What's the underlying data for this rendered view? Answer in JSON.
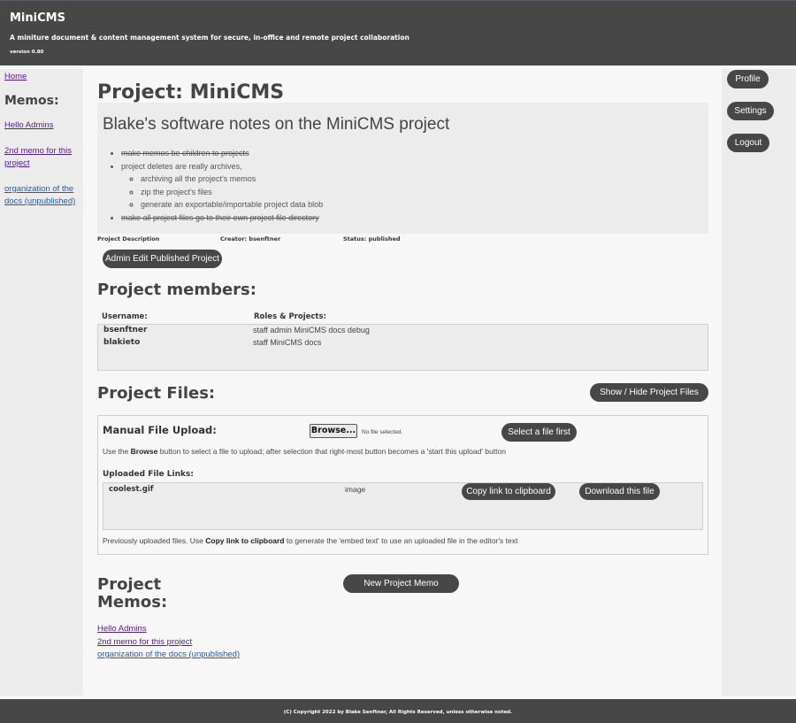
{
  "header": {
    "app_title": "MiniCMS",
    "tagline": "A miniture document & content management system for secure, in-office and remote project collaboration",
    "version": "version 0.80"
  },
  "left_sidebar": {
    "home": "Home",
    "memos_heading": "Memos:",
    "memos": [
      "Hello Admins",
      "2nd memo for this project",
      "organization of the docs (unpublished)"
    ]
  },
  "right_sidebar": {
    "profile": "Profile",
    "settings": "Settings",
    "logout": "Logout"
  },
  "main": {
    "title": "Project: MiniCMS",
    "description": {
      "heading": "Blake's software notes on the MiniCMS project",
      "items": [
        "make memos be children to projects",
        "project deletes are really archives,",
        "archiving all the project's memos",
        "zip the project's files",
        "generate an exportable/importable project data blob",
        "make all project files go to their own project file directory"
      ]
    },
    "meta": {
      "label": "Project Description",
      "creator": "Creator: bsenftner",
      "status": "Status: published"
    },
    "admin_edit_button": "Admin Edit Published Project",
    "members": {
      "heading": "Project members:",
      "col_username": "Username:",
      "col_roles": "Roles & Projects:",
      "rows": [
        {
          "username": "bsenftner",
          "roles": "staff admin MiniCMS docs debug"
        },
        {
          "username": "blakieto",
          "roles": "staff MiniCMS docs"
        }
      ]
    },
    "files": {
      "heading": "Project Files:",
      "toggle_button": "Show / Hide Project Files",
      "upload_heading": "Manual File Upload:",
      "browse_button": "Browse...",
      "no_file": "No file selected.",
      "select_button": "Select a file first",
      "help_pre": "Use the",
      "help_bold": "Browse",
      "help_post": "button to select a file to upload; after selection that right-most button becomes a 'start this upload' button",
      "uploaded_heading": "Uploaded File Links:",
      "files": [
        {
          "name": "coolest.gif",
          "type": "image",
          "copy_button": "Copy link to clipboard",
          "download_button": "Download this file"
        }
      ],
      "note_pre": "Previously uploaded files. Use",
      "note_bold": "Copy link to clipboard",
      "note_post": "to generate the 'embed text' to use an uploaded file in the editor's text"
    },
    "memos": {
      "heading_line1": "Project",
      "heading_line2": "Memos:",
      "new_button": "New Project Memo",
      "links": [
        "Hello Admins",
        "2nd memo for this project",
        "organization of the docs (unpublished)"
      ]
    }
  },
  "footer": {
    "copyright": "(C) Copyright 2022 by Blake Senftner, All Rights Reserved, unless otherwise noted."
  }
}
